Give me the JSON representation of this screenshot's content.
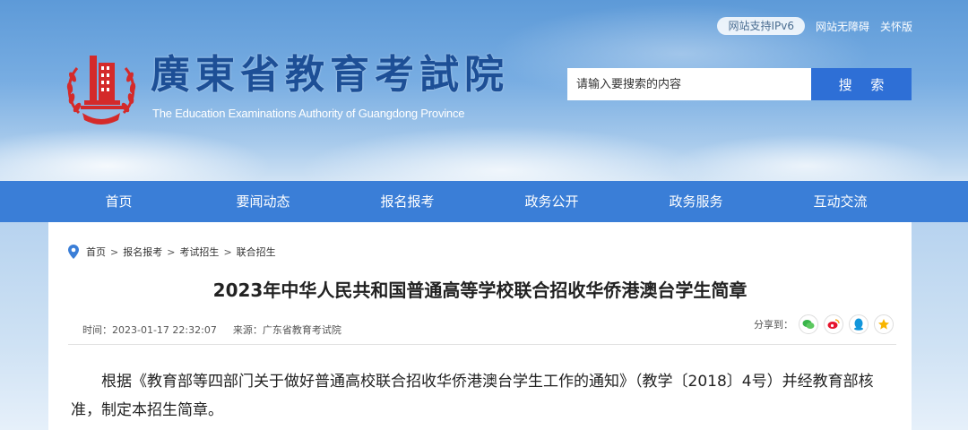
{
  "header": {
    "pill_label": "网站支持IPv6",
    "accessibility_label": "网站无障碍",
    "care_label": "关怀版",
    "site_title": "廣東省教育考試院",
    "site_subtitle": "The Education Examinations Authority of Guangdong Province",
    "search_placeholder": "请输入要搜索的内容",
    "search_button": "搜 索"
  },
  "nav": {
    "items": [
      "首页",
      "要闻动态",
      "报名报考",
      "政务公开",
      "政务服务",
      "互动交流"
    ]
  },
  "breadcrumb": [
    "首页",
    "报名报考",
    "考试招生",
    "联合招生"
  ],
  "article": {
    "title": "2023年中华人民共和国普通高等学校联合招收华侨港澳台学生简章",
    "time": "时间：2023-01-17 22:32:07",
    "source": "来源：广东省教育考试院",
    "share_label": "分享到：",
    "body": "根据《教育部等四部门关于做好普通高校联合招收华侨港澳台学生工作的通知》（教学〔2018〕4号）并经教育部核准，制定本招生简章。"
  },
  "colors": {
    "nav": "#3a7ed7",
    "search_button": "#2e6fd6",
    "emblem": "#d42a2a"
  },
  "share_icons": [
    "wechat-icon",
    "weibo-icon",
    "qq-icon",
    "qzone-icon"
  ]
}
